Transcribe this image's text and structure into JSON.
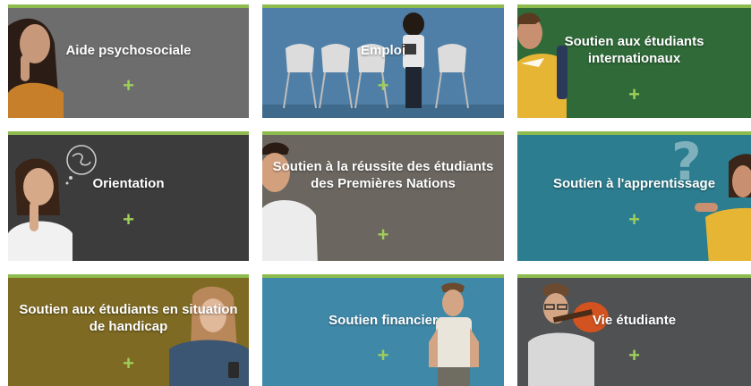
{
  "colors": {
    "accent": "#8dbb4e",
    "plus": "#9fcd5a",
    "text": "#ffffff"
  },
  "cards": [
    {
      "title": "Aide psychosociale",
      "icon": "plus-icon",
      "plus": "+"
    },
    {
      "title": "Emploi",
      "icon": "plus-icon",
      "plus": "+"
    },
    {
      "title": "Soutien aux étudiants internationaux",
      "icon": "plus-icon",
      "plus": "+"
    },
    {
      "title": "Orientation",
      "icon": "plus-icon",
      "plus": "+"
    },
    {
      "title": "Soutien à la réussite des étudiants des Premières Nations",
      "icon": "plus-icon",
      "plus": "+"
    },
    {
      "title": "Soutien à l'apprentissage",
      "icon": "plus-icon",
      "plus": "+"
    },
    {
      "title": "Soutien aux étudiants en situation de handicap",
      "icon": "plus-icon",
      "plus": "+"
    },
    {
      "title": "Soutien financier",
      "icon": "plus-icon",
      "plus": "+"
    },
    {
      "title": "Vie étudiante",
      "icon": "plus-icon",
      "plus": "+"
    }
  ]
}
